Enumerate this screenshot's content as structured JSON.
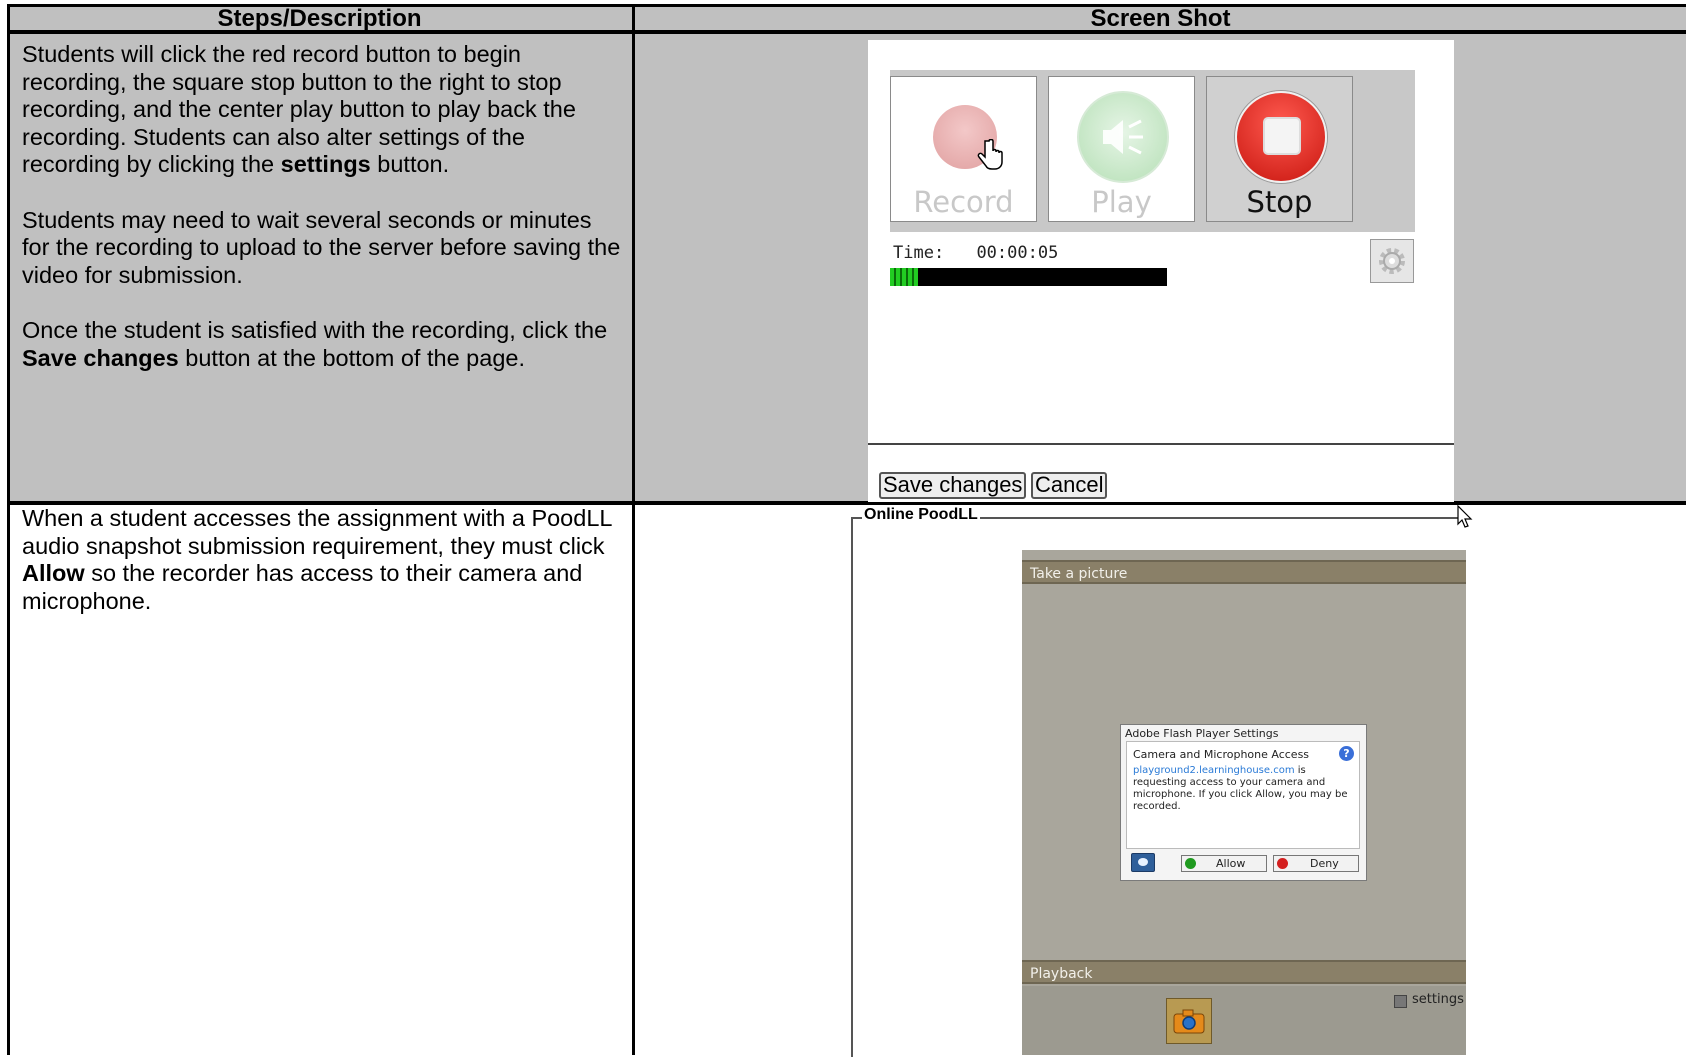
{
  "table": {
    "headers": [
      "Steps/Description",
      "Screen Shot"
    ]
  },
  "row1": {
    "para1_text": "Students will click the red record button to begin recording, the square stop button to the right to stop recording, and the center play button to play back the recording. Students can also alter settings of the recording by clicking the ",
    "para1_bold": "settings",
    "para1_end": " button.",
    "para2": "Students may need to wait several seconds or minutes for the recording to upload to the server before saving the video for submission.",
    "para3_text": "Once the student is satisfied with the recording, click the ",
    "para3_bold": "Save changes",
    "para3_end": " button at the bottom of the page."
  },
  "recorder": {
    "record_label": "Record",
    "play_label": "Play",
    "stop_label": "Stop",
    "time_label": "Time:",
    "time_value": "00:00:05",
    "save_label": "Save changes",
    "cancel_label": "Cancel",
    "icons": [
      "record-icon",
      "speaker-icon",
      "stop-icon",
      "gear-icon",
      "hand-cursor-icon"
    ]
  },
  "row2": {
    "text": "When a student accesses the assignment with a PoodLL audio snapshot submission requirement, they must click ",
    "bold": "Allow",
    "end": " so the recorder has access to their camera and microphone."
  },
  "snapshot": {
    "legend": "Online PoodLL",
    "take_picture": "Take a picture",
    "playback": "Playback",
    "settings_label": "settings",
    "flash_title": "Adobe Flash Player Settings",
    "flash_subtitle": "Camera and Microphone Access",
    "flash_domain": "playground2.learninghouse.com",
    "flash_body": " is requesting access to your camera and microphone. If you click Allow, you may be recorded.",
    "allow_label": "Allow",
    "deny_label": "Deny",
    "icons": [
      "camera-icon",
      "help-icon",
      "settings-icon",
      "arrow-cursor-icon"
    ]
  },
  "colors": {
    "grey_cell": "#c0c0c0",
    "stop_red": "#d9231d",
    "play_green": "#9fd89f",
    "progress_green": "#22cc22"
  }
}
